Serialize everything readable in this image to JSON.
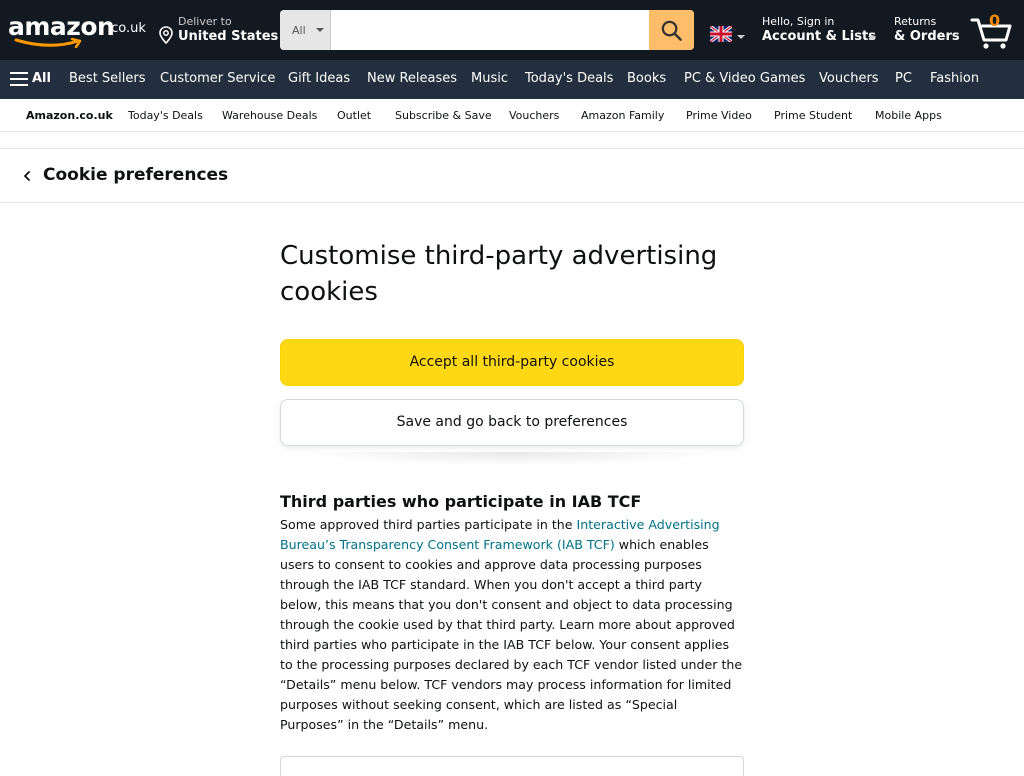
{
  "header": {
    "logo_text": "amazon",
    "logo_tld": ".co.uk",
    "deliver_line1": "Deliver to",
    "deliver_line2": "United States",
    "search_category": "All",
    "search_placeholder": "",
    "account_line1": "Hello, Sign in",
    "account_line2": "Account & Lists",
    "returns_line1": "Returns",
    "returns_line2": "& Orders",
    "cart_count": "0"
  },
  "main_nav": {
    "all_label": "All",
    "links": [
      "Best Sellers",
      "Customer Service",
      "Gift Ideas",
      "New Releases",
      "Music",
      "Today's Deals",
      "Books",
      "PC & Video Games",
      "Vouchers",
      "PC",
      "Fashion"
    ]
  },
  "sub_nav": {
    "links": [
      "Amazon.co.uk",
      "Today's Deals",
      "Warehouse Deals",
      "Outlet",
      "Subscribe & Save",
      "Vouchers",
      "Amazon Family",
      "Prime Video",
      "Prime Student",
      "Mobile Apps"
    ]
  },
  "breadcrumb": {
    "title": "Cookie preferences"
  },
  "content": {
    "heading": "Customise third-party advertising cookies",
    "accept_button": "Accept all third-party cookies",
    "save_button": "Save and go back to preferences",
    "section_title": "Third parties who participate in IAB TCF",
    "para_before_link": "Some approved third parties participate in the ",
    "para_link": "Interactive Advertising Bureau’s Transparency Consent Framework (IAB TCF)",
    "para_after_link": " which enables users to consent to cookies and approve data processing purposes through the IAB TCF standard. When you don't accept a third party below, this means that you don't consent and object to data processing through the cookie used by that third party. Learn more about approved third parties who participate in the IAB TCF below. Your consent applies to the processing purposes declared by each TCF vendor listed under the “Details” menu below. TCF vendors may process information for limited purposes without seeking consent, which are listed as “Special Purposes” in the “Details” menu."
  },
  "colors": {
    "nav_dark": "#131921",
    "nav_secondary": "#232f3e",
    "search_button": "#febd69",
    "primary_button": "#ffd814",
    "link": "#007185",
    "cart_count": "#f08804"
  },
  "icons": [
    "location-pin-icon",
    "search-icon",
    "uk-flag-icon",
    "cart-icon",
    "hamburger-icon",
    "chevron-left-icon"
  ]
}
